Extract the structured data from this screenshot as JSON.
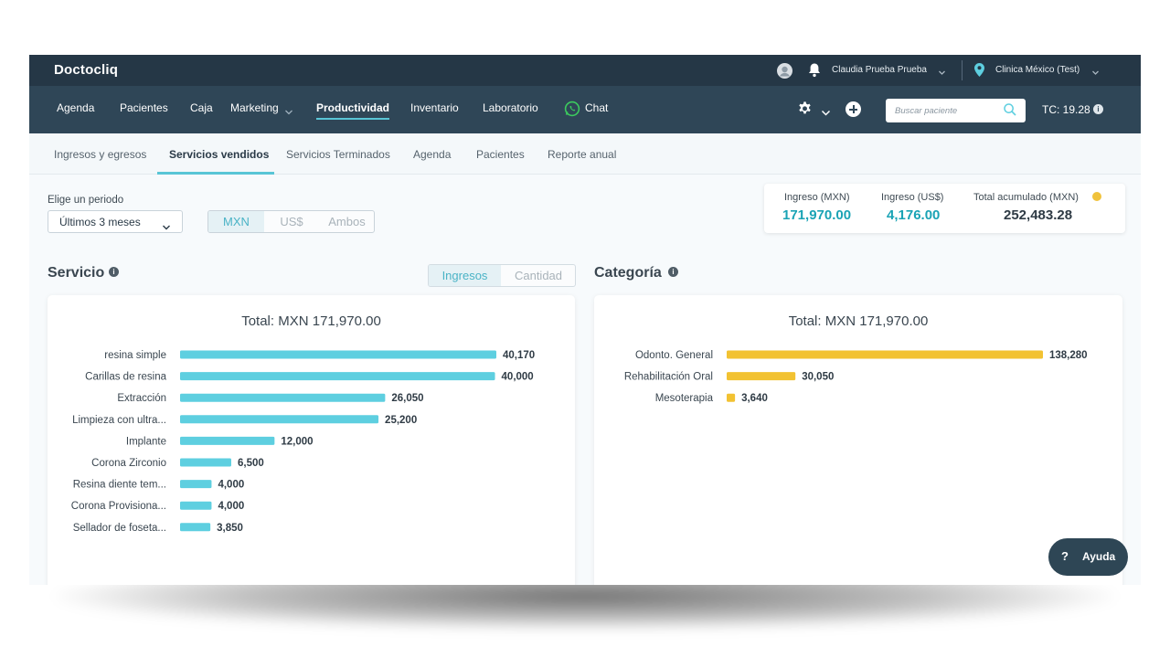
{
  "app": {
    "brand": "Doctocliq",
    "user_name": "Claudia Prueba Prueba",
    "clinic_name": "Clinica México (Test)"
  },
  "nav": {
    "items": [
      {
        "label": "Agenda",
        "active": false
      },
      {
        "label": "Pacientes",
        "active": false
      },
      {
        "label": "Caja",
        "active": false
      },
      {
        "label": "Marketing",
        "active": false
      },
      {
        "label": "Productividad",
        "active": true
      },
      {
        "label": "Inventario",
        "active": false
      },
      {
        "label": "Laboratorio",
        "active": false
      },
      {
        "label": "Chat",
        "active": false
      }
    ],
    "search_placeholder": "Buscar paciente",
    "tc_label": "TC: 19.28"
  },
  "subtabs": [
    {
      "label": "Ingresos y egresos",
      "active": false
    },
    {
      "label": "Servicios vendidos",
      "active": true
    },
    {
      "label": "Servicios Terminados",
      "active": false
    },
    {
      "label": "Agenda",
      "active": false
    },
    {
      "label": "Pacientes",
      "active": false
    },
    {
      "label": "Reporte anual",
      "active": false
    }
  ],
  "period": {
    "label": "Elige un periodo",
    "selected": "Últimos 3 meses"
  },
  "currency": {
    "options": [
      "MXN",
      "US$",
      "Ambos"
    ],
    "selected": "MXN"
  },
  "stats": {
    "ingreso_mxn_label": "Ingreso (MXN)",
    "ingreso_mxn_value": "171,970.00",
    "ingreso_usd_label": "Ingreso (US$)",
    "ingreso_usd_value": "4,176.00",
    "total_label": "Total acumulado (MXN)",
    "total_value": "252,483.28"
  },
  "servicio": {
    "title": "Servicio",
    "toggle": [
      "Ingresos",
      "Cantidad"
    ],
    "toggle_selected": "Ingresos",
    "total": "Total: MXN 171,970.00"
  },
  "categoria": {
    "title": "Categoría",
    "total": "Total: MXN 171,970.00"
  },
  "help": {
    "label": "Ayuda",
    "icon_text": "?"
  },
  "colors": {
    "topbar": "#253746",
    "nav": "#2f4657",
    "accent": "#59c5d6",
    "teal_value": "#1aa3b5",
    "bar_servicio": "#5ecfe0",
    "bar_categoria": "#f2c232"
  },
  "chart_data": [
    {
      "type": "bar",
      "orientation": "horizontal",
      "title": "Total: MXN 171,970.00",
      "categories": [
        "resina simple",
        "Carillas de resina",
        "Extracción",
        "Limpieza con ultra...",
        "Implante",
        "Corona Zirconio",
        "Resina diente tem...",
        "Corona Provisiona...",
        "Sellador de foseta..."
      ],
      "values": [
        40170,
        40000,
        26050,
        25200,
        12000,
        6500,
        4000,
        4000,
        3850
      ],
      "value_labels": [
        "40,170",
        "40,000",
        "26,050",
        "25,200",
        "12,000",
        "6,500",
        "4,000",
        "4,000",
        "3,850"
      ],
      "color": "#5ecfe0",
      "grid": false
    },
    {
      "type": "bar",
      "orientation": "horizontal",
      "title": "Total: MXN 171,970.00",
      "categories": [
        "Odonto. General",
        "Rehabilitación Oral",
        "Mesoterapia"
      ],
      "values": [
        138280,
        30050,
        3640
      ],
      "value_labels": [
        "138,280",
        "30,050",
        "3,640"
      ],
      "color": "#f2c232",
      "grid": false
    }
  ]
}
